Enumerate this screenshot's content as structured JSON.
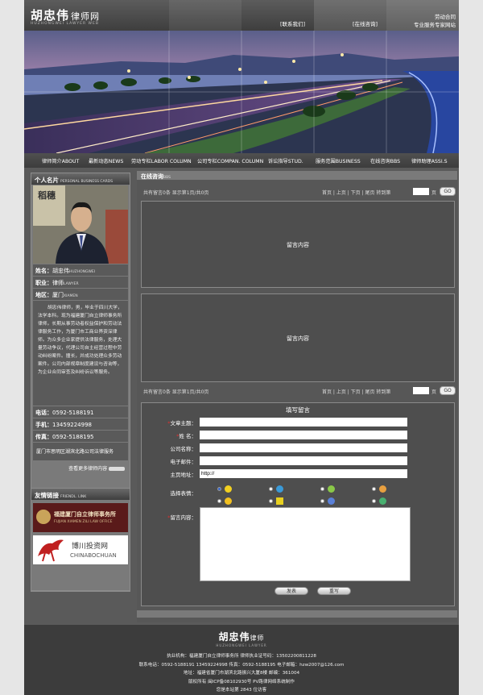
{
  "header": {
    "logo": "胡忠伟",
    "logo_sub": "律师网",
    "logo_en": "HUZHONGWEI LAWYER WEB",
    "nav1": "[联系我们]",
    "nav2": "[在线咨询]",
    "right1": "劳动合同",
    "right2": "专业服务专家网站"
  },
  "mainnav": {
    "items": [
      "律师简介ABOUT",
      "最新动态NEWS",
      "劳动专栏LABOR COLUMN",
      "公司专栏COMPAN. COLUMN",
      "诉讼指导STUD.",
      "服务范围BUSINESS",
      "在线咨询BBS",
      "律师助理ASSI.S"
    ]
  },
  "profile": {
    "title": "个人名片",
    "title_en": "PERSONAL BUSINESS CARDS",
    "photo_caption": "稻穗",
    "name_label": "姓名：",
    "name": "胡忠伟",
    "name_en": "HUZHONGWEI",
    "job_label": "职业：",
    "job": "律师",
    "job_en": "LAWYER",
    "region_label": "地区：",
    "region": "厦门",
    "region_en": "XIAMEN",
    "bio": "胡忠伟律师，男，毕业于四川大学，法学本科。现为福建厦门自立律师事务所律师。长期从事劳动者权益保护和劳动法律服务工作，为厦门市工商业界资深律师。为众多企业家提供法律服务，处理大量劳动争议，代理公司自主经营过程中劳动纠纷案件。擅长，并成功处理众多劳动案件。公司内部规章制度建设与咨询等，为企业合同审查及纠纷诉讼等服务。",
    "phone_label": "电话：",
    "phone": "0592-5188191",
    "mobile_label": "手机：",
    "mobile": "13459224998",
    "fax_label": "传真：",
    "fax": "0592-5188195",
    "address": "厦门市思明区湖滨北路公司法律服务",
    "more": "查看更多律师内容"
  },
  "links": {
    "title": "友情链接",
    "title_en": "FRIENDL. LINK",
    "link1_cn": "福建厦门自立律师事务所",
    "link1_en": "FUJIAN XIAMEN ZILI LAW OFFICE",
    "link2_cn": "博川投资网",
    "link2_en": "CHINABOCHUAN"
  },
  "main": {
    "title": "在线咨询",
    "title_en": "BBS",
    "pager_text": "共有留言0条 显示第1页/共0页",
    "pager_nav": "首页 | 上页 | 下页 | 尾页 转到第",
    "pager_unit": "页",
    "go": "GO",
    "msg1": "留言内容",
    "msg2": "留言内容"
  },
  "form": {
    "title": "填写留言",
    "topic_label": "文章主题：",
    "name_label": "姓 名：",
    "company_label": "公司名称：",
    "email_label": "电子邮件：",
    "homepage_label": "主页地址：",
    "homepage_value": "http://",
    "face_label": "选择表情：",
    "content_label": "留言内容：",
    "submit": "发表",
    "reset": "重写"
  },
  "footer": {
    "logo": "胡忠伟",
    "logo_sub": "律师",
    "logo_en": "HUZHONGWEI LAWYER",
    "line1": "执业机构：福建厦门自立律师事务所  律师执业证号码：13502200811228",
    "line2": "联系电话：0592-5188191 13459224998 传真：0592-5188195 电子邮箱：hzw2007@126.com",
    "line3": "地址：福建省厦门市湖滨北路振兴大厦8楼  邮编：361004",
    "line4": "版权所有  闽ICP备08102930号  PV路律网络系统制作",
    "line5": "您是本站第 2843 位访客"
  }
}
